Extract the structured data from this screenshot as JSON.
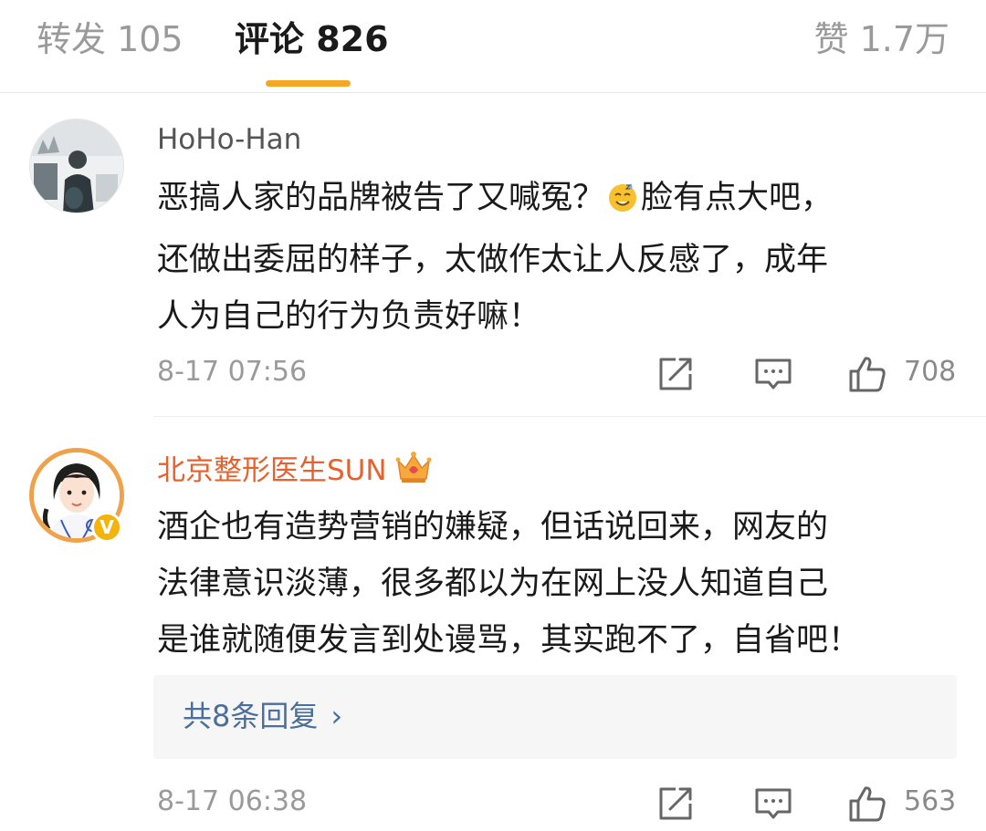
{
  "tabs": {
    "reposts": "转发 105",
    "comments": "评论 826",
    "likes": "赞 1.7万"
  },
  "colors": {
    "accent_underline": "#f5a623",
    "vip_username": "#e8602c",
    "reply_link": "#4a6f9a",
    "verified_badge": "#f5b40a"
  },
  "comments": [
    {
      "username": "HoHo-Han",
      "content_before_emoji": "恶搞人家的品牌被告了又喊冤？",
      "emoji": "sweat-smile-emoji",
      "content_after_emoji": "脸有点大吧，",
      "line2": "还做出委屈的样子，太做作太让人反感了，成年",
      "line3": "人为自己的行为负责好嘛！",
      "timestamp": "8-17 07:56",
      "likes": "708"
    },
    {
      "username": "北京整形医生SUN",
      "verified_mark": "V",
      "badge": "crown-icon",
      "line1": "酒企也有造势营销的嫌疑，但话说回来，网友的",
      "line2": "法律意识淡薄，很多都以为在网上没人知道自己",
      "line3": "是谁就随便发言到处谩骂，其实跑不了，自省吧！",
      "replies": "共8条回复",
      "replies_chevron": "›",
      "timestamp": "8-17 06:38",
      "likes": "563"
    }
  ]
}
